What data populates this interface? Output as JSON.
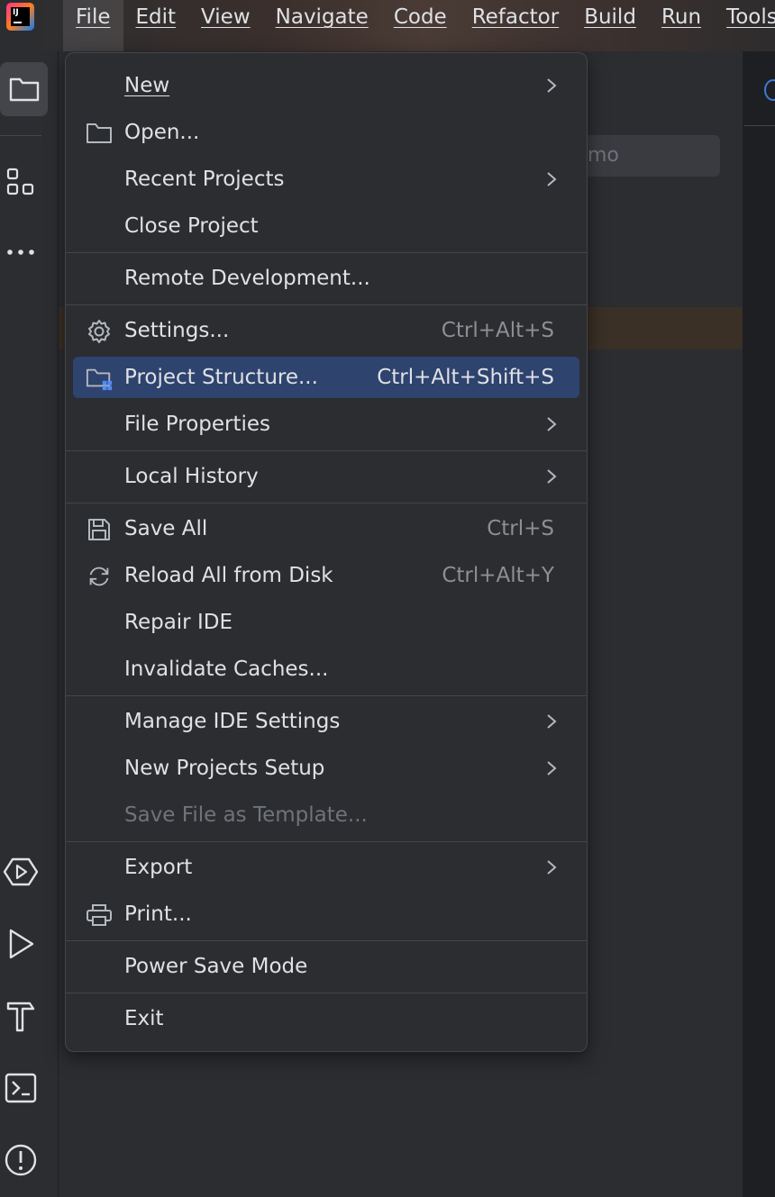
{
  "menubar": {
    "items": [
      "File",
      "Edit",
      "View",
      "Navigate",
      "Code",
      "Refactor",
      "Build",
      "Run",
      "Tools"
    ],
    "active_index": 0
  },
  "app_logo_text": "IJ",
  "background": {
    "search_placeholder_partial": "mo"
  },
  "file_menu": {
    "items": [
      {
        "label": "New",
        "shortcut": "",
        "submenu": true,
        "icon": "",
        "disabled": false,
        "selected": false
      },
      {
        "label": "Open...",
        "shortcut": "",
        "submenu": false,
        "icon": "folder-icon",
        "disabled": false,
        "selected": false
      },
      {
        "label": "Recent Projects",
        "shortcut": "",
        "submenu": true,
        "icon": "",
        "disabled": false,
        "selected": false
      },
      {
        "label": "Close Project",
        "shortcut": "",
        "submenu": false,
        "icon": "",
        "disabled": false,
        "selected": false
      },
      {
        "label": "Remote Development...",
        "shortcut": "",
        "submenu": false,
        "icon": "",
        "disabled": false,
        "selected": false
      },
      {
        "label": "Settings...",
        "shortcut": "Ctrl+Alt+S",
        "submenu": false,
        "icon": "gear-icon",
        "disabled": false,
        "selected": false
      },
      {
        "label": "Project Structure...",
        "shortcut": "Ctrl+Alt+Shift+S",
        "submenu": false,
        "icon": "project-structure-icon",
        "disabled": false,
        "selected": true
      },
      {
        "label": "File Properties",
        "shortcut": "",
        "submenu": true,
        "icon": "",
        "disabled": false,
        "selected": false
      },
      {
        "label": "Local History",
        "shortcut": "",
        "submenu": true,
        "icon": "",
        "disabled": false,
        "selected": false
      },
      {
        "label": "Save All",
        "shortcut": "Ctrl+S",
        "submenu": false,
        "icon": "save-icon",
        "disabled": false,
        "selected": false
      },
      {
        "label": "Reload All from Disk",
        "shortcut": "Ctrl+Alt+Y",
        "submenu": false,
        "icon": "reload-icon",
        "disabled": false,
        "selected": false
      },
      {
        "label": "Repair IDE",
        "shortcut": "",
        "submenu": false,
        "icon": "",
        "disabled": false,
        "selected": false
      },
      {
        "label": "Invalidate Caches...",
        "shortcut": "",
        "submenu": false,
        "icon": "",
        "disabled": false,
        "selected": false
      },
      {
        "label": "Manage IDE Settings",
        "shortcut": "",
        "submenu": true,
        "icon": "",
        "disabled": false,
        "selected": false
      },
      {
        "label": "New Projects Setup",
        "shortcut": "",
        "submenu": true,
        "icon": "",
        "disabled": false,
        "selected": false
      },
      {
        "label": "Save File as Template...",
        "shortcut": "",
        "submenu": false,
        "icon": "",
        "disabled": true,
        "selected": false
      },
      {
        "label": "Export",
        "shortcut": "",
        "submenu": true,
        "icon": "",
        "disabled": false,
        "selected": false
      },
      {
        "label": "Print...",
        "shortcut": "",
        "submenu": false,
        "icon": "print-icon",
        "disabled": false,
        "selected": false
      },
      {
        "label": "Power Save Mode",
        "shortcut": "",
        "submenu": false,
        "icon": "",
        "disabled": false,
        "selected": false
      },
      {
        "label": "Exit",
        "shortcut": "",
        "submenu": false,
        "icon": "",
        "disabled": false,
        "selected": false
      }
    ]
  },
  "left_toolbar": {
    "top": [
      "project-folder-icon",
      "structure-icon",
      "more-icon"
    ],
    "bottom": [
      "services-icon",
      "run-icon",
      "build-icon",
      "terminal-icon",
      "problems-icon"
    ]
  },
  "colors": {
    "menu_bg": "#2b2d30",
    "selection": "#2e436e",
    "text": "#dfe1e5",
    "shortcut_text": "#8c8f94",
    "disabled_text": "#6f737a"
  }
}
